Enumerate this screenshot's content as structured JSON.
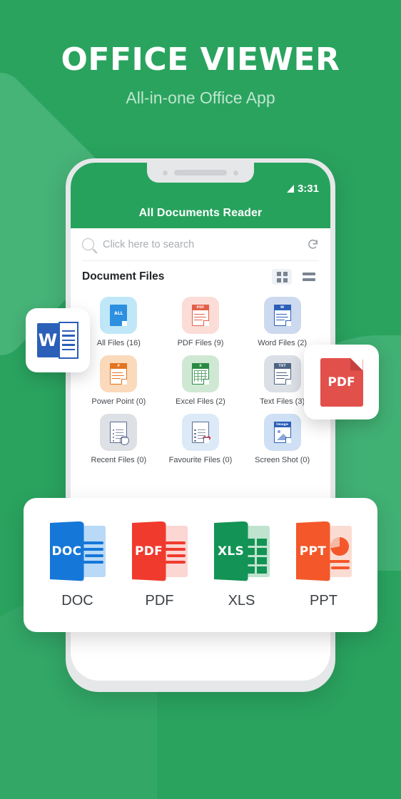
{
  "theme": {
    "brand_green": "#27a25d",
    "bg_green": "#2aa35f",
    "subtitle_green": "#bfe6ce"
  },
  "hero": {
    "title": "OFFICE VIEWER",
    "subtitle": "All-in-one Office App"
  },
  "phone": {
    "status_bar": {
      "signal_icon": "signal-triangle-icon",
      "time": "3:31"
    },
    "appbar": {
      "title": "All Documents Reader"
    },
    "search": {
      "icon": "search-icon",
      "placeholder": "Click here to search",
      "refresh_icon": "refresh-icon"
    },
    "section": {
      "title": "Document Files",
      "grid_view_icon": "grid-view-icon",
      "list_view_icon": "list-view-icon",
      "active_view": "grid"
    },
    "tiles": [
      {
        "label": "All Files (16)",
        "badge": "ALL",
        "tile_bg": "#bfe7f7",
        "accent": "#2d8fe0",
        "icon": "all-files-icon",
        "style": "solid"
      },
      {
        "label": "PDF Files (9)",
        "badge": "PDF",
        "tile_bg": "#fbdcd6",
        "accent": "#e2604a",
        "icon": "pdf-files-icon",
        "style": "lines"
      },
      {
        "label": "Word Files (2)",
        "badge": "W",
        "tile_bg": "#ccd9ef",
        "accent": "#2b5fb8",
        "icon": "word-files-icon",
        "style": "lines"
      },
      {
        "label": "Power Point (0)",
        "badge": "P",
        "tile_bg": "#fbd9bb",
        "accent": "#e4741f",
        "icon": "powerpoint-files-icon",
        "style": "lines"
      },
      {
        "label": "Excel Files (2)",
        "badge": "X",
        "tile_bg": "#cfe8d3",
        "accent": "#2a8a43",
        "icon": "excel-files-icon",
        "style": "xgrid"
      },
      {
        "label": "Text Files (3)",
        "badge": "TXT",
        "tile_bg": "#dbdfe6",
        "accent": "#4d6382",
        "icon": "text-files-icon",
        "style": "lines"
      },
      {
        "label": "Recent Files (0)",
        "badge": "",
        "tile_bg": "#dde0e5",
        "accent": "#5b6a90",
        "icon": "recent-files-icon",
        "style": "check"
      },
      {
        "label": "Favourite Files (0)",
        "badge": "",
        "tile_bg": "#dceaf8",
        "accent": "#5b6a90",
        "icon": "favourite-files-icon",
        "style": "heart"
      },
      {
        "label": "Screen Shot (0)",
        "badge": "Image",
        "tile_bg": "#cfe0f5",
        "accent": "#2b5fb8",
        "icon": "screenshot-files-icon",
        "style": "image"
      }
    ]
  },
  "float_cards": {
    "word": {
      "icon": "word-logo-icon",
      "letter": "W"
    },
    "pdf": {
      "icon": "pdf-logo-icon",
      "label": "PDF"
    }
  },
  "formats": [
    {
      "label": "DOC",
      "badge": "DOC",
      "dark": "#1577d8",
      "light": "#b8d9f7",
      "glyph": "lines"
    },
    {
      "label": "PDF",
      "badge": "PDF",
      "dark": "#f03a2d",
      "light": "#fbd6d3",
      "glyph": "lines"
    },
    {
      "label": "XLS",
      "badge": "XLS",
      "dark": "#139355",
      "light": "#bfe3cf",
      "glyph": "cells"
    },
    {
      "label": "PPT",
      "badge": "PPT",
      "dark": "#f4582a",
      "light": "#fbdcd3",
      "glyph": "pie"
    }
  ]
}
